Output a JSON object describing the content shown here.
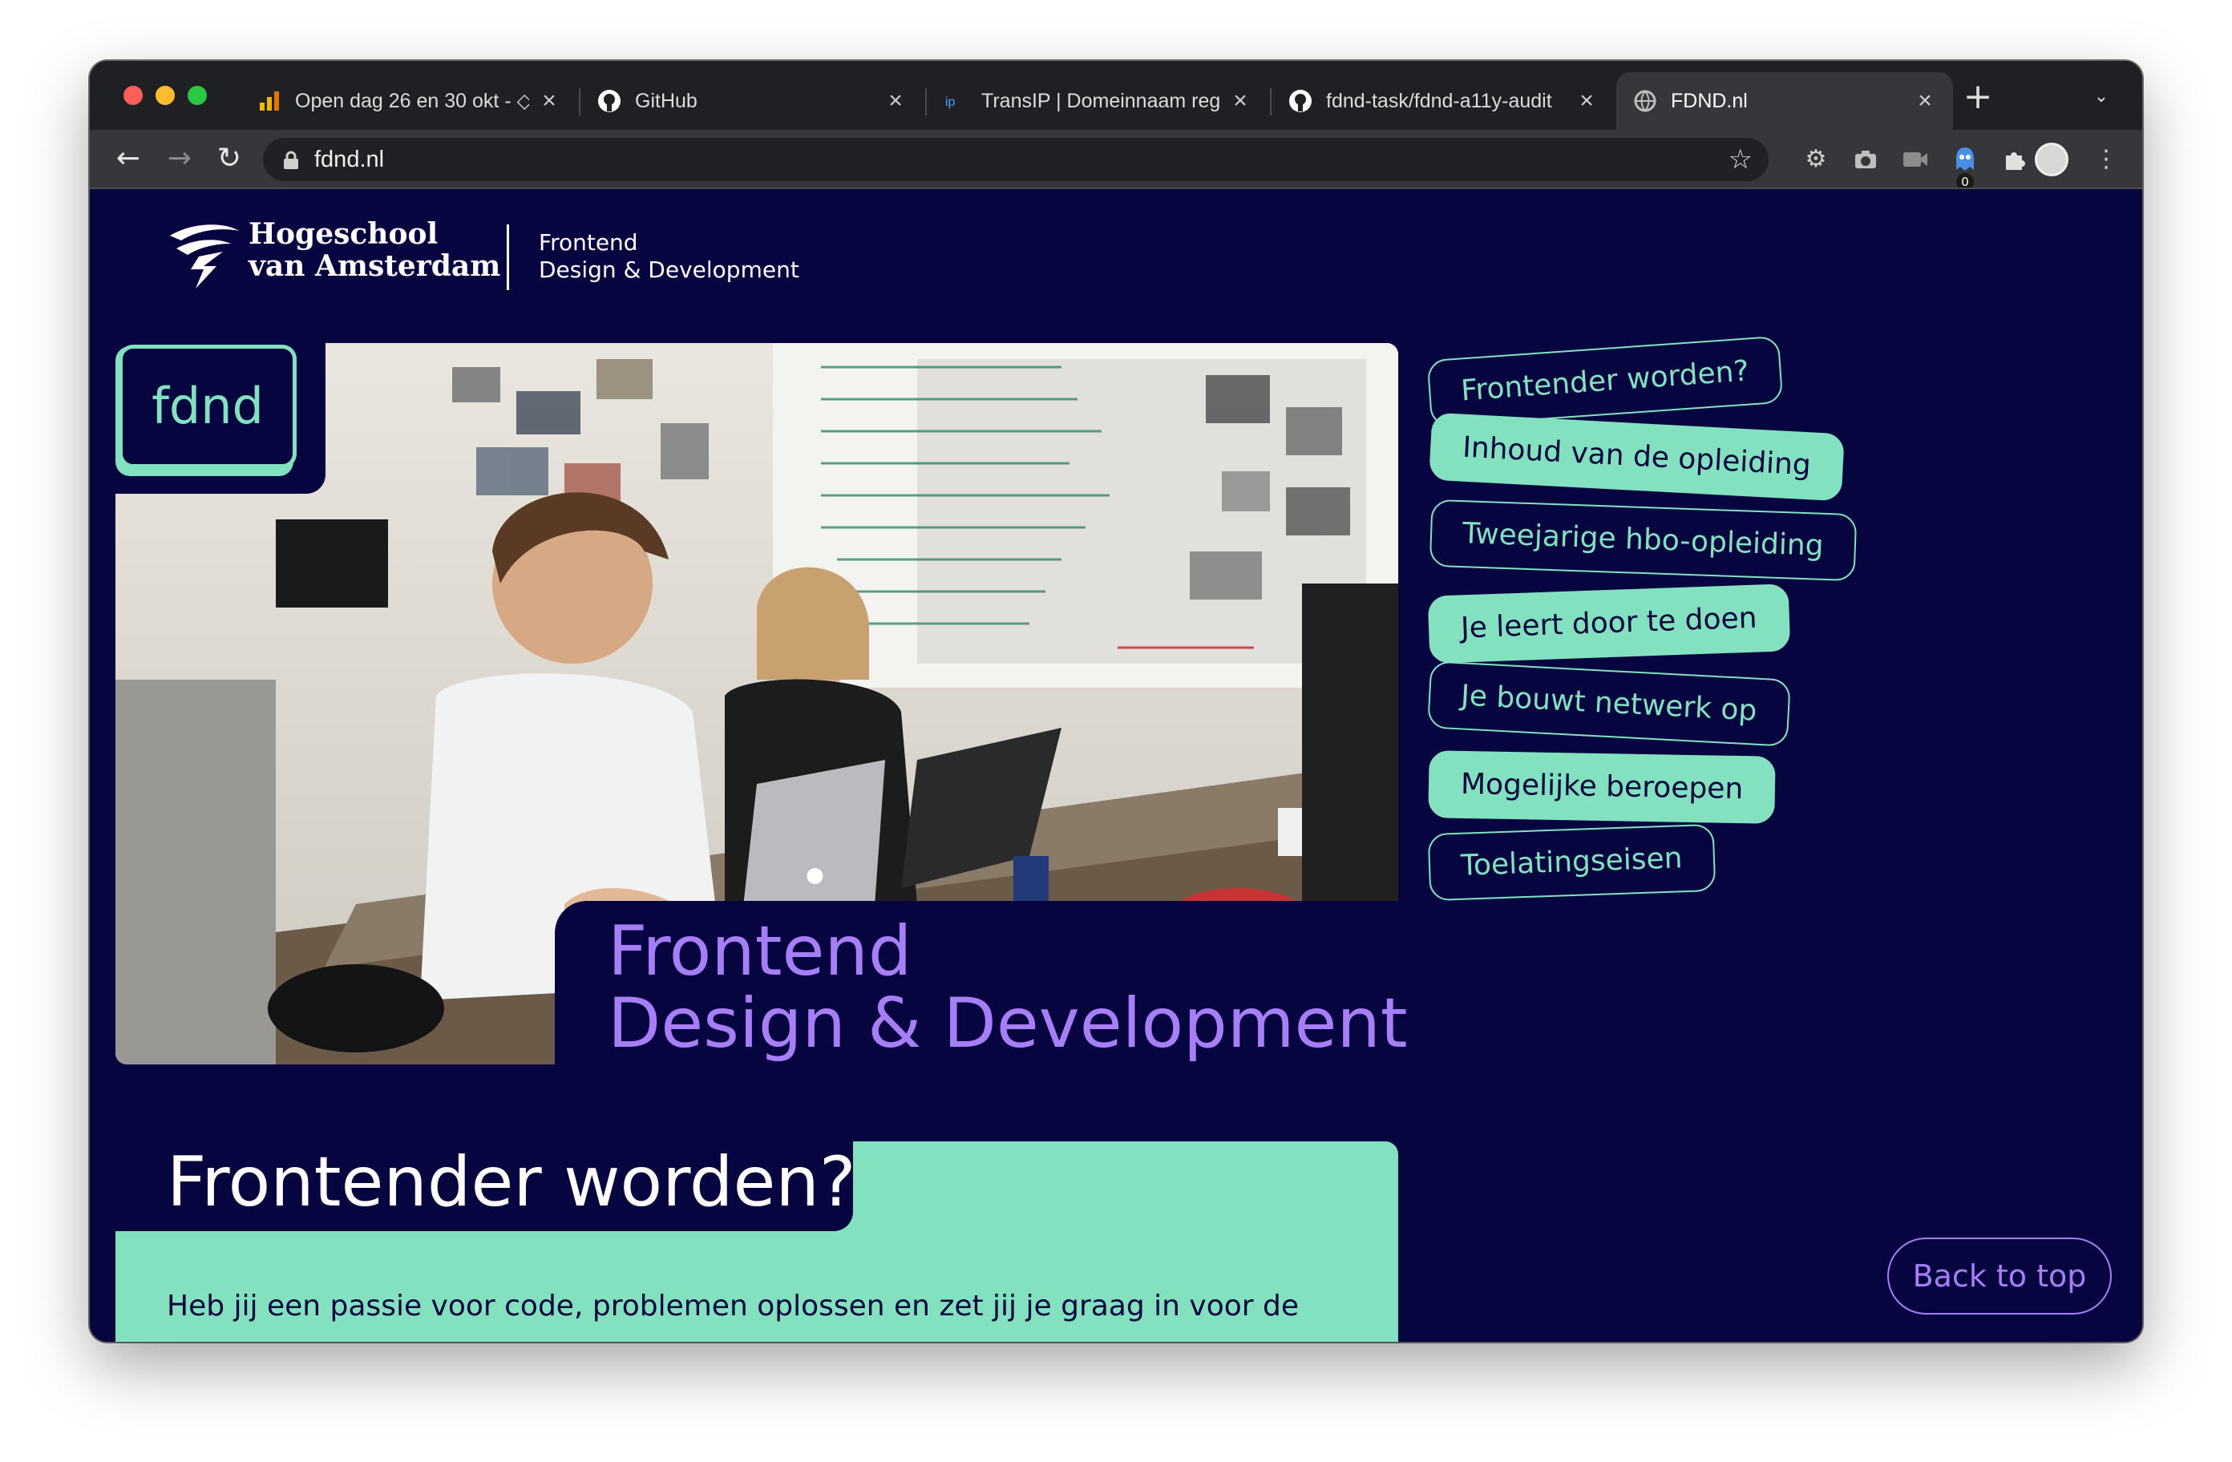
{
  "browser": {
    "tabs": [
      {
        "title": "Open dag 26 en 30 okt - ◇",
        "icon": "analytics-icon"
      },
      {
        "title": "GitHub",
        "icon": "github-icon"
      },
      {
        "title": "TransIP | Domeinnaam reg",
        "icon": "transip-icon"
      },
      {
        "title": "fdnd-task/fdnd-a11y-audit",
        "icon": "github-icon"
      },
      {
        "title": "FDND.nl",
        "icon": "globe-icon",
        "active": true
      }
    ],
    "new_tab_label": "+",
    "url": "fdnd.nl",
    "extension_badge": "0"
  },
  "header": {
    "org_line1": "Hogeschool",
    "org_line2": "van Amsterdam",
    "program_line1": "Frontend",
    "program_line2": "Design & Development"
  },
  "hero": {
    "badge": "fdnd",
    "title_line1": "Frontend",
    "title_line2": "Design & Development",
    "photo_alt": "Students working on laptops in a studio"
  },
  "side_nav": [
    {
      "label": "Frontender worden?",
      "style": "outline"
    },
    {
      "label": "Inhoud van de opleiding",
      "style": "filled"
    },
    {
      "label": "Tweejarige hbo-opleiding",
      "style": "outline"
    },
    {
      "label": "Je leert door te doen",
      "style": "filled"
    },
    {
      "label": "Je bouwt netwerk op",
      "style": "outline"
    },
    {
      "label": "Mogelijke beroepen",
      "style": "filled"
    },
    {
      "label": "Toelatingseisen",
      "style": "outline"
    }
  ],
  "section": {
    "title": "Frontender worden?",
    "intro": "Heb jij een passie voor code, problemen oplossen en zet jij je graag in voor de"
  },
  "back_to_top": "Back to top",
  "colors": {
    "background": "#07053f",
    "mint": "#83e1bf",
    "purple": "#a77ef8"
  }
}
